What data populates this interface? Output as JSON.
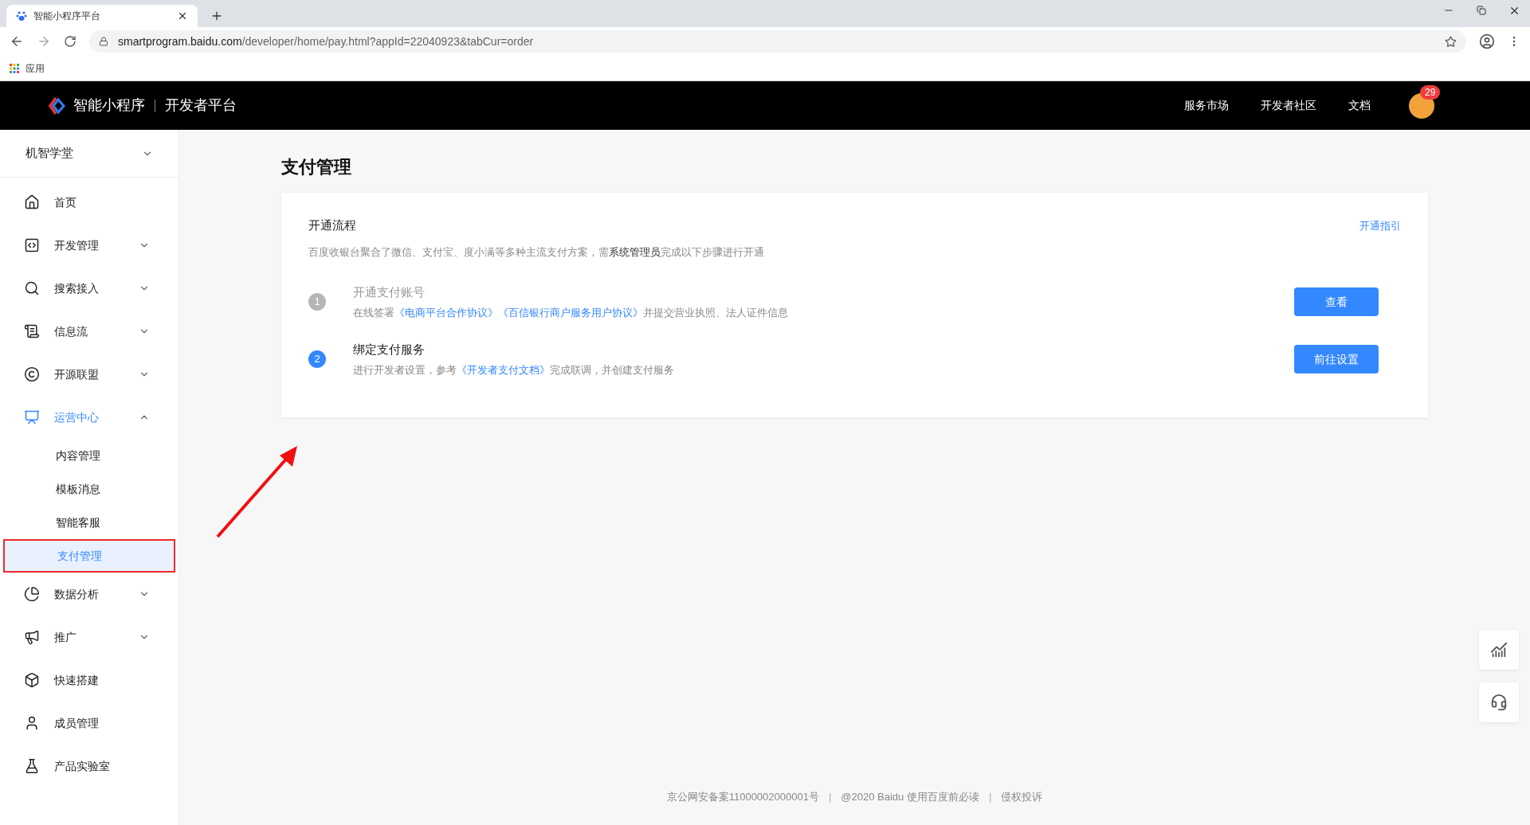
{
  "browser": {
    "tab_title": "智能小程序平台",
    "url_host": "smartprogram.baidu.com",
    "url_path": "/developer/home/pay.html?appId=22040923&tabCur=order",
    "bookmark": "应用"
  },
  "header": {
    "logo_text": "智能小程序",
    "platform": "开发者平台",
    "nav": [
      "服务市场",
      "开发者社区",
      "文档"
    ],
    "badge": "29"
  },
  "sidebar": {
    "account": "机智学堂",
    "items": [
      {
        "label": "首页",
        "kind": "link",
        "selected": false
      },
      {
        "label": "开发管理",
        "kind": "group",
        "expanded": false,
        "selected": false
      },
      {
        "label": "搜索接入",
        "kind": "group",
        "expanded": false,
        "selected": false
      },
      {
        "label": "信息流",
        "kind": "group",
        "expanded": false,
        "selected": false
      },
      {
        "label": "开源联盟",
        "kind": "group",
        "expanded": false,
        "selected": false
      },
      {
        "label": "运营中心",
        "kind": "group",
        "expanded": true,
        "selected": true,
        "children": [
          {
            "label": "内容管理",
            "selected": false
          },
          {
            "label": "模板消息",
            "selected": false
          },
          {
            "label": "智能客服",
            "selected": false
          },
          {
            "label": "支付管理",
            "selected": true
          }
        ]
      },
      {
        "label": "数据分析",
        "kind": "group",
        "expanded": false,
        "selected": false
      },
      {
        "label": "推广",
        "kind": "group",
        "expanded": false,
        "selected": false
      },
      {
        "label": "快速搭建",
        "kind": "link",
        "selected": false
      },
      {
        "label": "成员管理",
        "kind": "link",
        "selected": false
      },
      {
        "label": "产品实验室",
        "kind": "link",
        "selected": false
      }
    ]
  },
  "page": {
    "title": "支付管理",
    "card": {
      "title": "开通流程",
      "guide_link": "开通指引",
      "description": "百度收银台聚合了微信、支付宝、度小满等多种主流支付方案，需**系统管理员**完成以下步骤进行开通",
      "steps": [
        {
          "number": "1",
          "title": "开通支付账号",
          "active": false,
          "parts": [
            {
              "text": "在线签署",
              "link": false
            },
            {
              "text": "《电商平台合作协议》",
              "link": true
            },
            {
              "text": "《百信银行商户服务用户协议》",
              "link": true
            },
            {
              "text": "并提交营业执照、法人证件信息",
              "link": false
            }
          ],
          "button": "查看"
        },
        {
          "number": "2",
          "title": "绑定支付服务",
          "active": true,
          "parts": [
            {
              "text": "进行开发者设置，参考",
              "link": false
            },
            {
              "text": "《开发者支付文档》",
              "link": true
            },
            {
              "text": "完成联调，并创建支付服务",
              "link": false
            }
          ],
          "button": "前往设置"
        }
      ]
    }
  },
  "footer": [
    {
      "text": "京公网安备案11000002000001号",
      "kind": "text"
    },
    {
      "text": "|",
      "kind": "separator"
    },
    {
      "text": "@2020 Baidu 使用百度前必读",
      "kind": "text"
    },
    {
      "text": "|",
      "kind": "separator"
    },
    {
      "text": "侵权投诉",
      "kind": "text"
    }
  ]
}
